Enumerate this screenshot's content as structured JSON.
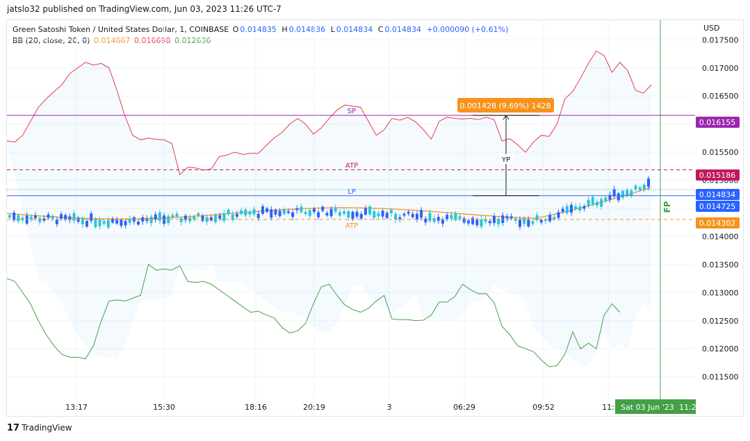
{
  "header": {
    "publisher": "jatslo32 published on TradingView.com, Jun 03, 2023 11:26 UTC-7"
  },
  "legend": {
    "symbol": "Green Satoshi Token / United States Dollar, 1, COINBASE",
    "ohlc": [
      {
        "label": "O",
        "value": "0.014835"
      },
      {
        "label": "H",
        "value": "0.014836"
      },
      {
        "label": "L",
        "value": "0.014834"
      },
      {
        "label": "C",
        "value": "0.014834"
      }
    ],
    "change": "+0.000090 (+0.61%)",
    "bb_label": "BB (20, close, 20, 0)",
    "bb_values": [
      "0.014667",
      "0.016698",
      "0.012636"
    ]
  },
  "colors": {
    "basis": "#f7931a",
    "upper": "#e8384f",
    "lower": "#43a047",
    "candle_up": "#26c6da",
    "candle_down": "#2962ff",
    "sp_line": "#9c27b0",
    "atp_line": "#c2185b",
    "lp_line": "#2962ff",
    "atp2_line": "#f7931a",
    "fp_line": "#43a047",
    "yp_box": "#f7931a"
  },
  "chart_data": {
    "type": "candlestick",
    "currency_label": "USD",
    "ylim": [
      0.0111,
      0.01785
    ],
    "y_ticks": [
      "0.011500",
      "0.012000",
      "0.012500",
      "0.013000",
      "0.013500",
      "0.014000",
      "0.014500",
      "0.015000",
      "0.015500",
      "0.016000",
      "0.016500",
      "0.017000",
      "0.017500"
    ],
    "x_ticks": [
      "13:17",
      "15:30",
      "18:16",
      "20:19",
      "3",
      "06:29",
      "09:52",
      "11:"
    ],
    "x_date_label": "Sat 03 Jun '23",
    "x_time_label": "11:2",
    "levels": [
      {
        "name": "SP",
        "value": 0.016155,
        "price_label": "0.016155",
        "style": "solid",
        "color": "#9c27b0"
      },
      {
        "name": "ATP",
        "value": 0.015186,
        "price_label": "0.015186",
        "style": "dashed",
        "color": "#c2185b"
      },
      {
        "name": "LP",
        "value": 0.014725,
        "price_label": "0.014725",
        "style": "solid",
        "color": "#2962ff"
      },
      {
        "name": "ATP",
        "value": 0.014302,
        "price_label": "0.014302",
        "style": "dashed",
        "color": "#f7931a"
      }
    ],
    "last_price": {
      "value": 0.014834,
      "label": "0.014834"
    },
    "fp_label": "FP",
    "measure": {
      "label": "YP",
      "box_text": "0.001428 (9.69%) 1428",
      "from": 0.014725,
      "to": 0.016155
    },
    "bb_upper": [
      0.0157,
      0.01568,
      0.0158,
      0.01605,
      0.0163,
      0.01645,
      0.01658,
      0.0167,
      0.0169,
      0.017,
      0.0171,
      0.01705,
      0.01708,
      0.017,
      0.0166,
      0.01615,
      0.0158,
      0.01572,
      0.01575,
      0.01573,
      0.01572,
      0.01565,
      0.0151,
      0.01523,
      0.01522,
      0.01518,
      0.0152,
      0.01542,
      0.01545,
      0.0155,
      0.01546,
      0.01548,
      0.01548,
      0.01562,
      0.01575,
      0.01585,
      0.016,
      0.0161,
      0.016,
      0.01582,
      0.01593,
      0.0161,
      0.01625,
      0.01634,
      0.01632,
      0.0163,
      0.01605,
      0.0158,
      0.0159,
      0.0161,
      0.01607,
      0.01612,
      0.01604,
      0.0159,
      0.01573,
      0.01605,
      0.01612,
      0.0161,
      0.01609,
      0.0161,
      0.01608,
      0.01612,
      0.01608,
      0.0157,
      0.01574,
      0.01563,
      0.0155,
      0.01568,
      0.0158,
      0.01578,
      0.016,
      0.01645,
      0.01658,
      0.01682,
      0.01708,
      0.0173,
      0.01722,
      0.01692,
      0.0171,
      0.01695,
      0.0166,
      0.01655,
      0.0167
    ],
    "bb_lower": [
      0.01325,
      0.0132,
      0.013,
      0.0128,
      0.0125,
      0.01225,
      0.01205,
      0.0119,
      0.01185,
      0.01185,
      0.01182,
      0.01205,
      0.0125,
      0.01285,
      0.01287,
      0.01285,
      0.0129,
      0.01295,
      0.0135,
      0.0134,
      0.01342,
      0.0134,
      0.01348,
      0.0132,
      0.01318,
      0.0132,
      0.01315,
      0.01305,
      0.01295,
      0.01285,
      0.01275,
      0.01265,
      0.01267,
      0.0126,
      0.01255,
      0.01238,
      0.01228,
      0.01232,
      0.01245,
      0.0128,
      0.0131,
      0.01315,
      0.01295,
      0.01278,
      0.0127,
      0.01265,
      0.01272,
      0.01285,
      0.01295,
      0.01253,
      0.01252,
      0.01252,
      0.0125,
      0.01251,
      0.0126,
      0.01283,
      0.01283,
      0.01293,
      0.01315,
      0.01305,
      0.01298,
      0.01298,
      0.01282,
      0.0124,
      0.01225,
      0.01205,
      0.012,
      0.01195,
      0.0118,
      0.01168,
      0.0117,
      0.0119,
      0.0123,
      0.012,
      0.0121,
      0.012,
      0.0126,
      0.0128,
      0.01265
    ]
  },
  "axis_badges": [
    "0.016155",
    "0.015186",
    "0.014834",
    "0.014725",
    "0.014302"
  ],
  "footer": {
    "brand": "TradingView",
    "logo": "tradingview-logo"
  }
}
